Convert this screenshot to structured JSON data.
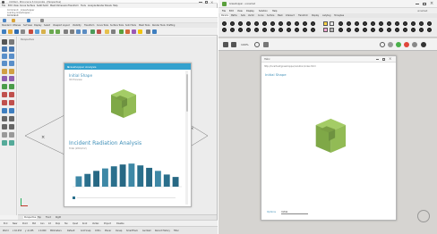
{
  "rhino": {
    "title": "Untitled - Rhinoceros 6 Corporate - [Perspective]",
    "menu": [
      "File",
      "Edit",
      "View",
      "Curve",
      "Surface",
      "SubD",
      "Solid",
      "Mesh",
      "Dimension",
      "Transform",
      "Tools",
      "Analyze",
      "Render",
      "Panels",
      "Help"
    ],
    "history": [
      "Command: _Grasshopper",
      "Loading Grasshopper...",
      "Command:"
    ],
    "tabs": [
      "Standard",
      "CPlanes",
      "Set View",
      "Display",
      "Select",
      "Viewport Layout",
      "Visibility",
      "Transform",
      "Curve Tools",
      "Surface Tools",
      "Solid Tools",
      "Mesh Tools",
      "Render Tools",
      "Drafting"
    ],
    "viewport_label": "Perspective",
    "viewport_tabs": [
      "Perspective",
      "Top",
      "Front",
      "Right"
    ],
    "osnaps": [
      "End",
      "Near",
      "Point",
      "Mid",
      "Cen",
      "Int",
      "Perp",
      "Tan",
      "Quad",
      "Knot",
      "Vertex",
      "Project",
      "Disable"
    ],
    "status": [
      "World",
      "x 10.253",
      "y -4.185",
      "z 0.000",
      "Millimeters",
      "Default",
      "Grid Snap",
      "Ortho",
      "Planar",
      "Osnap",
      "SmartTrack",
      "Gumball",
      "Record History",
      "Filter"
    ]
  },
  "dialog1": {
    "header": "Grasshopper Analysis",
    "model_title": "Initial Shape",
    "model_sub": "3D Preview",
    "chart_title": "Incident Radiation Analysis",
    "chart_sub": "Total (kWh/m2)"
  },
  "chart_data": {
    "type": "bar",
    "title": "Incident Radiation Analysis",
    "categories": [
      "",
      "",
      "",
      "",
      "",
      "",
      "",
      "",
      "",
      "",
      "",
      ""
    ],
    "values": [
      34,
      42,
      52,
      60,
      67,
      73,
      76,
      70,
      62,
      52,
      40,
      32
    ],
    "ylim": [
      0,
      100
    ],
    "colors": [
      "#3e88a6",
      "#2a6f8c",
      "#276884"
    ]
  },
  "gh": {
    "title": "Grasshopper - unnamed",
    "menu": [
      "File",
      "Edit",
      "View",
      "Display",
      "Solution",
      "Help"
    ],
    "tabs": [
      "Params",
      "Maths",
      "Sets",
      "Vector",
      "Curve",
      "Surface",
      "Mesh",
      "Intersect",
      "Transform",
      "Display",
      "Ladybug",
      "Honeybee"
    ],
    "zoom": "100%",
    "doc_name": "unnamed"
  },
  "dialog2": {
    "header": "Hélix",
    "url": "http://localhost/grasshopper/solution/index.html",
    "model_title": "Initial Shape",
    "footer_label": "Options",
    "footer_value": "Initial"
  }
}
